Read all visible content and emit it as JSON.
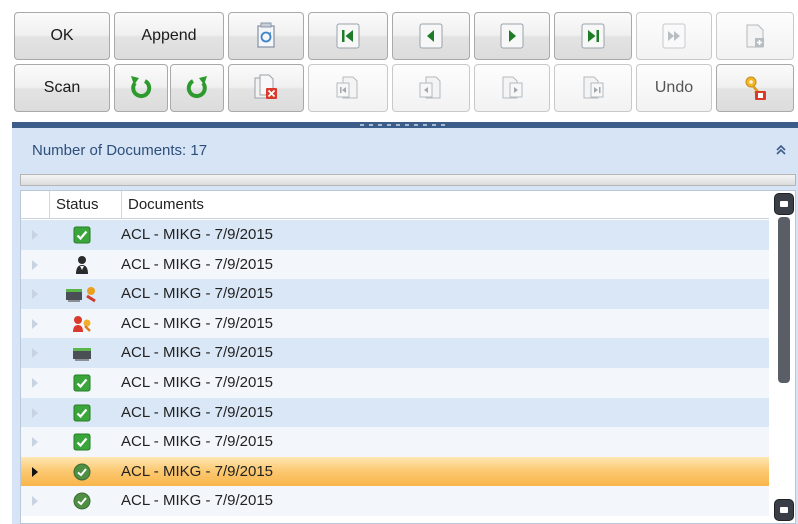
{
  "toolbar": {
    "ok_label": "OK",
    "append_label": "Append",
    "scan_label": "Scan",
    "undo_label": "Undo"
  },
  "panel": {
    "title": "Number of Documents: 17"
  },
  "grid": {
    "columns": [
      "Status",
      "Documents"
    ],
    "rows": [
      {
        "status": "check-icon",
        "document": "ACL - MIKG - 7/9/2015"
      },
      {
        "status": "person-icon",
        "document": "ACL - MIKG - 7/9/2015"
      },
      {
        "status": "scanner-key-icon",
        "document": "ACL - MIKG - 7/9/2015"
      },
      {
        "status": "user-key-icon",
        "document": "ACL - MIKG - 7/9/2015"
      },
      {
        "status": "scanner-icon",
        "document": "ACL - MIKG - 7/9/2015"
      },
      {
        "status": "check-icon",
        "document": "ACL - MIKG - 7/9/2015"
      },
      {
        "status": "check-icon",
        "document": "ACL - MIKG - 7/9/2015"
      },
      {
        "status": "check-icon",
        "document": "ACL - MIKG - 7/9/2015"
      },
      {
        "status": "ok-circle-icon",
        "document": "ACL - MIKG - 7/9/2015",
        "selected": true
      },
      {
        "status": "ok-circle-icon",
        "document": "ACL - MIKG - 7/9/2015"
      }
    ]
  },
  "colors": {
    "header_band": "#d6e4f5",
    "splitter": "#3c5d89",
    "selected_row": "#fcc973",
    "green": "#2e9b2e"
  }
}
